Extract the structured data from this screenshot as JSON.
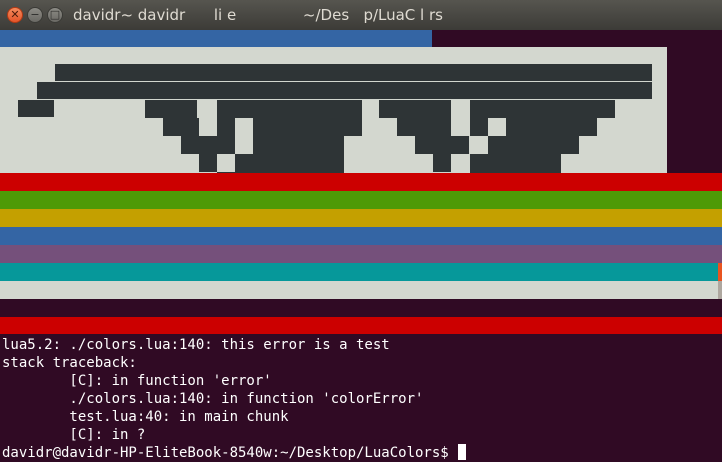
{
  "window": {
    "title": "davidr~ davidr      li e              ~/Des   p/LuaC l rs"
  },
  "colors": {
    "background": "#300a24",
    "blue": "#3465a4",
    "light_gray": "#d3d7cf",
    "dark_gray": "#2e3436",
    "red": "#cc0000",
    "green": "#4e9a06",
    "yellow": "#c4a000",
    "magenta": "#75507b",
    "cyan": "#06989a"
  },
  "terminal": {
    "lines": [
      "lua5.2: ./colors.lua:140: this error is a test",
      "stack traceback:",
      "        [C]: in function 'error'",
      "        ./colors.lua:140: in function 'colorError'",
      "        test.lua:40: in main chunk",
      "        [C]: in ?"
    ],
    "prompt": "davidr@davidr-HP-EliteBook-8540w:~/Desktop/LuaColors$ "
  }
}
